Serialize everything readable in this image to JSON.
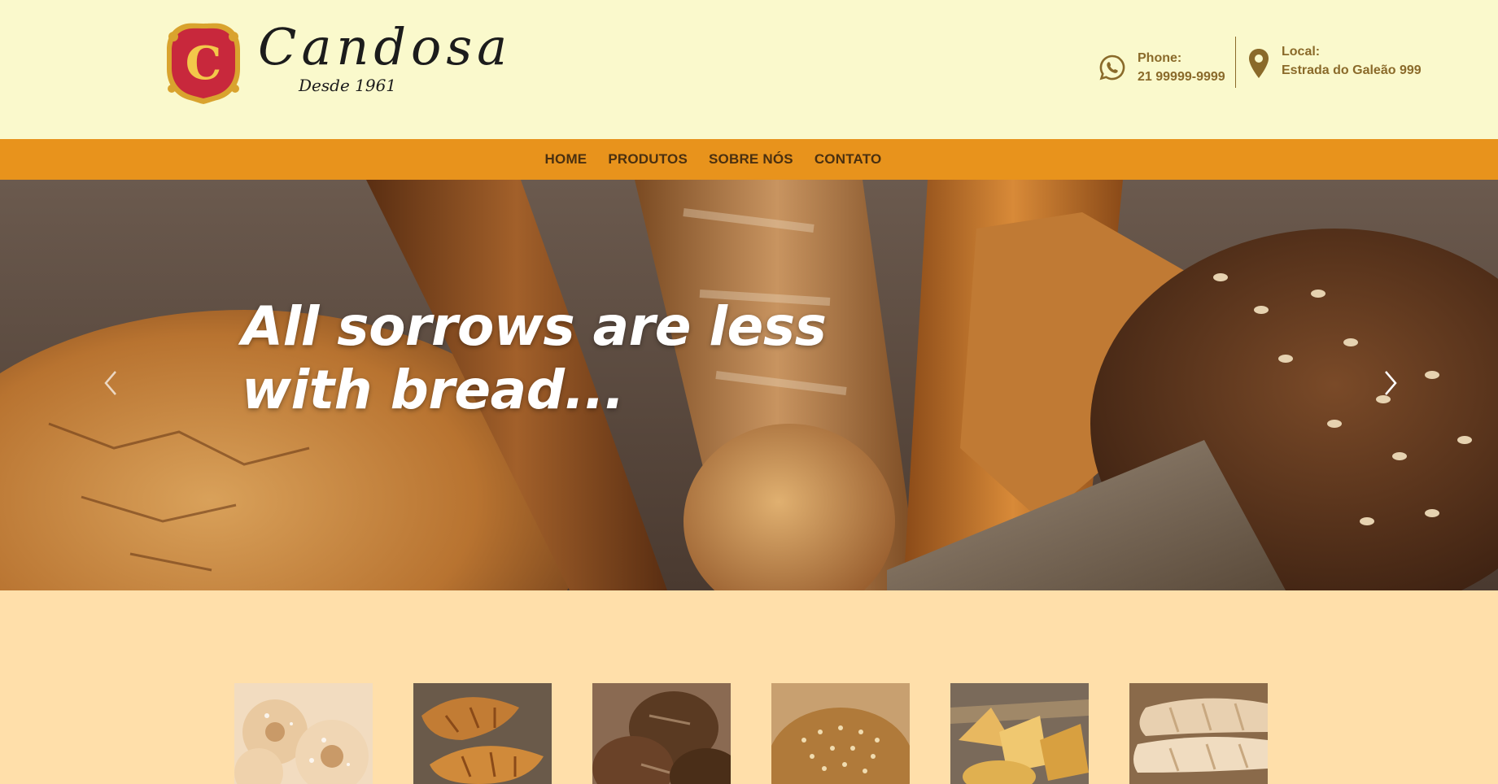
{
  "header": {
    "brand_name": "Candosa",
    "brand_sub": "Desde 1961",
    "crest_letter": "C",
    "phone": {
      "label": "Phone:",
      "value": "21 99999-9999",
      "icon": "whatsapp-icon"
    },
    "local": {
      "label": "Local:",
      "value": "Estrada do Galeão 999",
      "icon": "map-pin-icon"
    }
  },
  "nav": {
    "items": [
      {
        "label": "HOME"
      },
      {
        "label": "PRODUTOS"
      },
      {
        "label": "SOBRE NÓS"
      },
      {
        "label": "CONTATO"
      }
    ]
  },
  "hero": {
    "title_line1": "All sorrows are less",
    "title_line2": "with bread...",
    "prev_icon": "chevron-left-icon",
    "next_icon": "chevron-right-icon"
  },
  "products": {
    "thumbnails": [
      {
        "name": "powdered-donuts"
      },
      {
        "name": "croissants"
      },
      {
        "name": "rustic-rolls"
      },
      {
        "name": "sesame-bun"
      },
      {
        "name": "pastries-basket"
      },
      {
        "name": "baguettes"
      }
    ]
  },
  "colors": {
    "header_bg": "#FAF9CC",
    "nav_bg": "#E8931C",
    "body_bg": "#FFDFAA",
    "text_brown": "#8a6a2a",
    "nav_text": "#4a3010",
    "crest_red": "#C8283C",
    "crest_gold": "#E8B830"
  }
}
